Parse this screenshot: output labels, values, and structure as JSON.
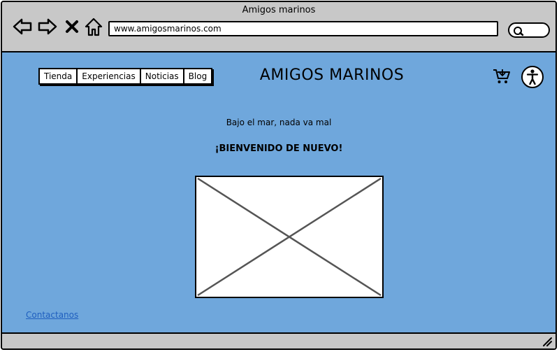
{
  "window": {
    "title": "Amigos marinos"
  },
  "browser": {
    "url": "www.amigosmarinos.com",
    "icons": {
      "back": "back-arrow-icon",
      "forward": "forward-arrow-icon",
      "stop": "close-icon",
      "home": "home-icon",
      "search": "search-icon"
    }
  },
  "nav": {
    "items": [
      {
        "label": "Tienda"
      },
      {
        "label": "Experiencias"
      },
      {
        "label": "Noticias"
      },
      {
        "label": "Blog"
      }
    ]
  },
  "header": {
    "site_title": "AMIGOS MARINOS",
    "icons": {
      "cart": "shopping-cart-icon",
      "accessibility": "accessibility-icon"
    }
  },
  "main": {
    "tagline": "Bajo el mar, nada va mal",
    "welcome": "¡BIENVENIDO DE NUEVO!",
    "image": "image-placeholder"
  },
  "footer": {
    "contact_link": "Contactanos"
  },
  "colors": {
    "content_bg": "#6fa7dc",
    "chrome_bg": "#c8c8c8",
    "link": "#1f5fbf"
  }
}
